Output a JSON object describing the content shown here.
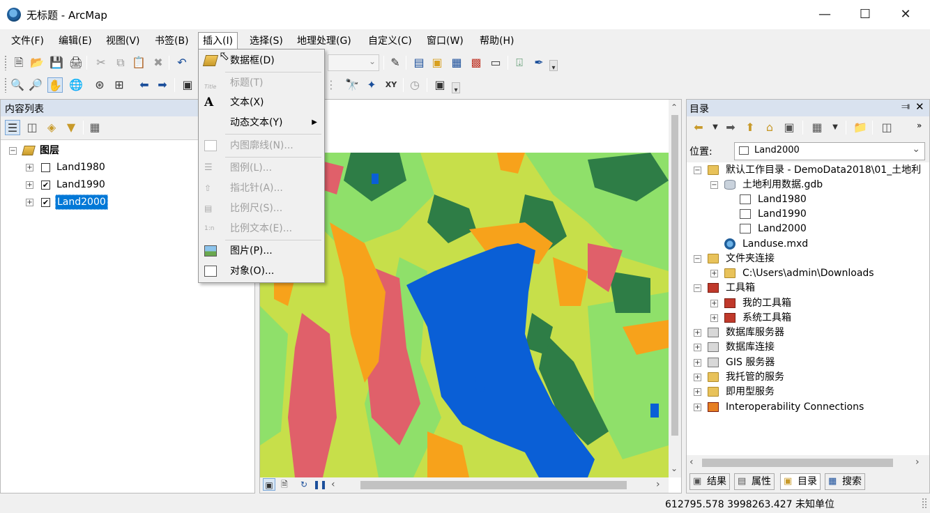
{
  "window": {
    "title": "无标题 - ArcMap",
    "minimize_icon": "minimize-icon",
    "maximize_icon": "maximize-icon",
    "close_icon": "close-icon"
  },
  "menubar": {
    "items": [
      "文件(F)",
      "编辑(E)",
      "视图(V)",
      "书签(B)",
      "插入(I)",
      "选择(S)",
      "地理处理(G)",
      "自定义(C)",
      "窗口(W)",
      "帮助(H)"
    ],
    "active": "插入(I)"
  },
  "insert_menu": {
    "items": [
      {
        "label": "数据框(D)",
        "icon": "data-frame-icon",
        "enabled": true
      },
      {
        "label": "标题(T)",
        "icon": "title-icon",
        "enabled": false
      },
      {
        "label": "文本(X)",
        "icon": "text-icon",
        "enabled": true
      },
      {
        "label": "动态文本(Y)",
        "icon": "",
        "enabled": true,
        "submenu": true
      },
      {
        "label": "内图廓线(N)...",
        "icon": "neatline-icon",
        "enabled": false
      },
      {
        "label": "图例(L)...",
        "icon": "legend-icon",
        "enabled": false
      },
      {
        "label": "指北针(A)...",
        "icon": "north-arrow-icon",
        "enabled": false
      },
      {
        "label": "比例尺(S)...",
        "icon": "scale-bar-icon",
        "enabled": false
      },
      {
        "label": "比例文本(E)...",
        "icon": "scale-text-icon",
        "enabled": false
      },
      {
        "label": "图片(P)...",
        "icon": "picture-icon",
        "enabled": true
      },
      {
        "label": "对象(O)...",
        "icon": "object-icon",
        "enabled": true
      }
    ]
  },
  "toc": {
    "title": "内容列表",
    "root": "图层",
    "layers": [
      {
        "name": "Land1980",
        "checked": false,
        "selected": false
      },
      {
        "name": "Land1990",
        "checked": true,
        "selected": false
      },
      {
        "name": "Land2000",
        "checked": true,
        "selected": true
      }
    ]
  },
  "catalog": {
    "title": "目录",
    "location_label": "位置:",
    "location_value": "Land2000",
    "tree": [
      {
        "label": "默认工作目录 - DemoData2018\\01_土地利",
        "level": 0,
        "icon": "folder-home-icon",
        "expander": "-"
      },
      {
        "label": "土地利用数据.gdb",
        "level": 1,
        "icon": "gdb-icon",
        "expander": "-"
      },
      {
        "label": "Land1980",
        "level": 2,
        "icon": "raster-icon",
        "expander": ""
      },
      {
        "label": "Land1990",
        "level": 2,
        "icon": "raster-icon",
        "expander": ""
      },
      {
        "label": "Land2000",
        "level": 2,
        "icon": "raster-icon",
        "expander": ""
      },
      {
        "label": "Landuse.mxd",
        "level": 1,
        "icon": "mxd-icon",
        "expander": ""
      },
      {
        "label": "文件夹连接",
        "level": 0,
        "icon": "folder-icon",
        "expander": "-"
      },
      {
        "label": "C:\\Users\\admin\\Downloads",
        "level": 1,
        "icon": "folder-icon",
        "expander": "+"
      },
      {
        "label": "工具箱",
        "level": 0,
        "icon": "toolbox-icon",
        "expander": "-"
      },
      {
        "label": "我的工具箱",
        "level": 1,
        "icon": "toolbox-icon",
        "expander": "+"
      },
      {
        "label": "系统工具箱",
        "level": 1,
        "icon": "toolbox-icon",
        "expander": "+"
      },
      {
        "label": "数据库服务器",
        "level": 0,
        "icon": "server-icon",
        "expander": "+"
      },
      {
        "label": "数据库连接",
        "level": 0,
        "icon": "server-icon",
        "expander": "+"
      },
      {
        "label": "GIS 服务器",
        "level": 0,
        "icon": "server-icon",
        "expander": "+"
      },
      {
        "label": "我托管的服务",
        "level": 0,
        "icon": "folder-icon",
        "expander": "+"
      },
      {
        "label": "即用型服务",
        "level": 0,
        "icon": "folder-icon",
        "expander": "+"
      },
      {
        "label": "Interoperability Connections",
        "level": 0,
        "icon": "toolbox-icon",
        "expander": "+"
      }
    ],
    "tabs": [
      "结果",
      "属性",
      "目录",
      "搜索"
    ],
    "active_tab": "目录"
  },
  "status": {
    "coordinates": "612795.578  3998263.427 未知单位"
  },
  "map_colors": {
    "water": "#0a5fd6",
    "grassland": "#c7df4a",
    "forest": "#2e7d46",
    "cropland": "#8fe06a",
    "urban": "#e0606a",
    "bare": "#f7a21b"
  }
}
